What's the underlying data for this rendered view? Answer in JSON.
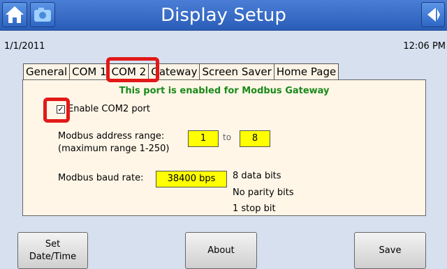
{
  "header": {
    "title": "Display Setup",
    "home_icon": "home-icon",
    "camera_icon": "camera-icon",
    "back_icon": "back-arrow-icon"
  },
  "status_bar": {
    "date": "1/1/2011",
    "time": "12:06 PM"
  },
  "tabs": [
    {
      "label": "General"
    },
    {
      "label": "COM 1"
    },
    {
      "label": "COM 2",
      "active": true
    },
    {
      "label": "Gateway"
    },
    {
      "label": "Screen Saver"
    },
    {
      "label": "Home Page"
    }
  ],
  "panel": {
    "status_message": "This port is enabled for Modbus Gateway",
    "enable_checkbox": {
      "checked": true,
      "label": "Enable COM2 port"
    },
    "address_range": {
      "label_line1": "Modbus address range:",
      "label_line2": "(maximum range 1-250)",
      "from": "1",
      "to_label": "to",
      "to": "8"
    },
    "baud": {
      "label": "Modbus baud rate:",
      "value": "38400 bps",
      "data_bits": "8 data bits",
      "parity": "No parity bits",
      "stop_bits": "1 stop bit"
    }
  },
  "buttons": {
    "set_datetime_line1": "Set",
    "set_datetime_line2": "Date/Time",
    "about": "About",
    "save": "Save"
  },
  "colors": {
    "title_bar": "#2a5db8",
    "status_green": "#1a8a1a",
    "highlight_yellow": "#ffff00",
    "annotation_red": "#e21818",
    "background": "#d6e0ef",
    "panel": "#fff6e8"
  }
}
